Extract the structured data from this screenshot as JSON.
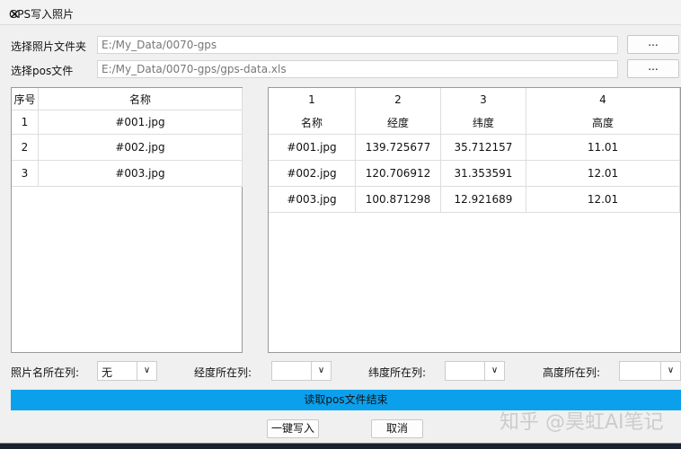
{
  "title": "GPS写入照片",
  "folder": {
    "label": "选择照片文件夹",
    "value": "E:/My_Data/0070-gps",
    "browse": "..."
  },
  "pos": {
    "label": "选择pos文件",
    "value": "E:/My_Data/0070-gps/gps-data.xls",
    "browse": "..."
  },
  "left_table": {
    "headers": [
      "序号",
      "名称"
    ],
    "rows": [
      [
        "1",
        "#001.jpg"
      ],
      [
        "2",
        "#002.jpg"
      ],
      [
        "3",
        "#003.jpg"
      ]
    ]
  },
  "right_table": {
    "col_numbers": [
      "1",
      "2",
      "3",
      "4"
    ],
    "headers": [
      "名称",
      "经度",
      "纬度",
      "高度"
    ],
    "rows": [
      [
        "#001.jpg",
        "139.725677",
        "35.712157",
        "11.01"
      ],
      [
        "#002.jpg",
        "120.706912",
        "31.353591",
        "12.01"
      ],
      [
        "#003.jpg",
        "100.871298",
        "12.921689",
        "12.01"
      ]
    ]
  },
  "selectors": [
    {
      "label": "照片名所在列:",
      "value": "无"
    },
    {
      "label": "经度所在列:",
      "value": ""
    },
    {
      "label": "纬度所在列:",
      "value": ""
    },
    {
      "label": "高度所在列:",
      "value": ""
    }
  ],
  "status": "读取pos文件结束",
  "buttons": {
    "write": "一键写入",
    "cancel": "取消"
  },
  "watermark": "知乎 @昊虹AI笔记",
  "colors": {
    "progress": "#0aa0ec"
  }
}
